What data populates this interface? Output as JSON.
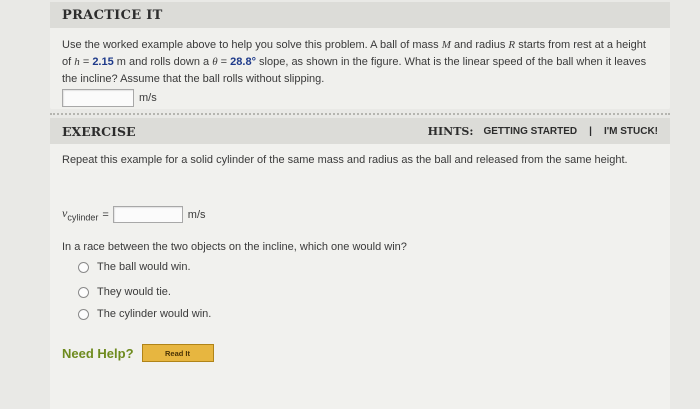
{
  "practice": {
    "title": "PRACTICE IT",
    "text_1": "Use the worked example above to help you solve this problem. A ball of mass",
    "var_M": "M",
    "text_2": "and radius",
    "var_R": "R",
    "text_3": "starts from rest at a height of",
    "var_h": "h",
    "eq_1": "=",
    "h_value": "2.15",
    "text_4": "m and rolls down a",
    "var_theta": "θ",
    "eq_2": "=",
    "theta_value": "28.8°",
    "text_5": "slope, as shown in the figure. What is the linear speed of the ball when it leaves the incline? Assume that the ball rolls without slipping.",
    "answer_unit": "m/s"
  },
  "exercise": {
    "title": "EXERCISE",
    "hints_label": "HINTS:",
    "hint_getting_started": "GETTING STARTED",
    "hint_separator": "|",
    "hint_stuck": "I'M STUCK!",
    "prompt": "Repeat this example for a solid cylinder of the same mass and radius as the ball and released from the same height.",
    "v_symbol": "v",
    "v_subscript": "cylinder",
    "v_equals": "=",
    "v_unit": "m/s",
    "question": "In a race between the two objects on the incline, which one would win?",
    "options": [
      "The ball would win.",
      "They would tie.",
      "The cylinder would win."
    ]
  },
  "help": {
    "label": "Need Help?",
    "read_button": "Read It"
  }
}
